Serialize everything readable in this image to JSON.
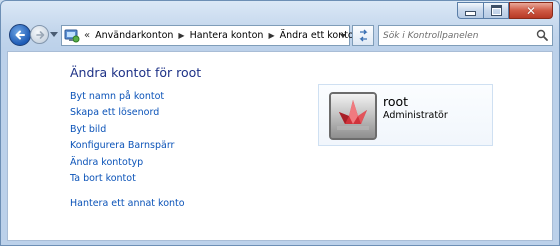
{
  "address_bar": {
    "breadcrumbs": [
      "Användarkonton",
      "Hantera konton",
      "Ändra ett konto"
    ]
  },
  "search": {
    "placeholder": "Sök i Kontrollpanelen"
  },
  "main": {
    "heading": "Ändra kontot för root",
    "links": [
      "Byt namn på kontot",
      "Skapa ett lösenord",
      "Byt bild",
      "Konfigurera Barnspärr",
      "Ändra kontotyp",
      "Ta bort kontot"
    ],
    "other_link": "Hantera ett annat konto"
  },
  "account": {
    "name": "root",
    "type": "Administratör"
  },
  "icons": {
    "back": "back-arrow-icon",
    "forward": "forward-arrow-icon",
    "control_panel": "control-panel-icon",
    "refresh": "refresh-icon",
    "search": "search-icon",
    "avatar": "origami-crane-picture"
  },
  "colors": {
    "heading": "#1e3287",
    "link": "#0b53b8",
    "chrome": "#c3d6ec"
  }
}
